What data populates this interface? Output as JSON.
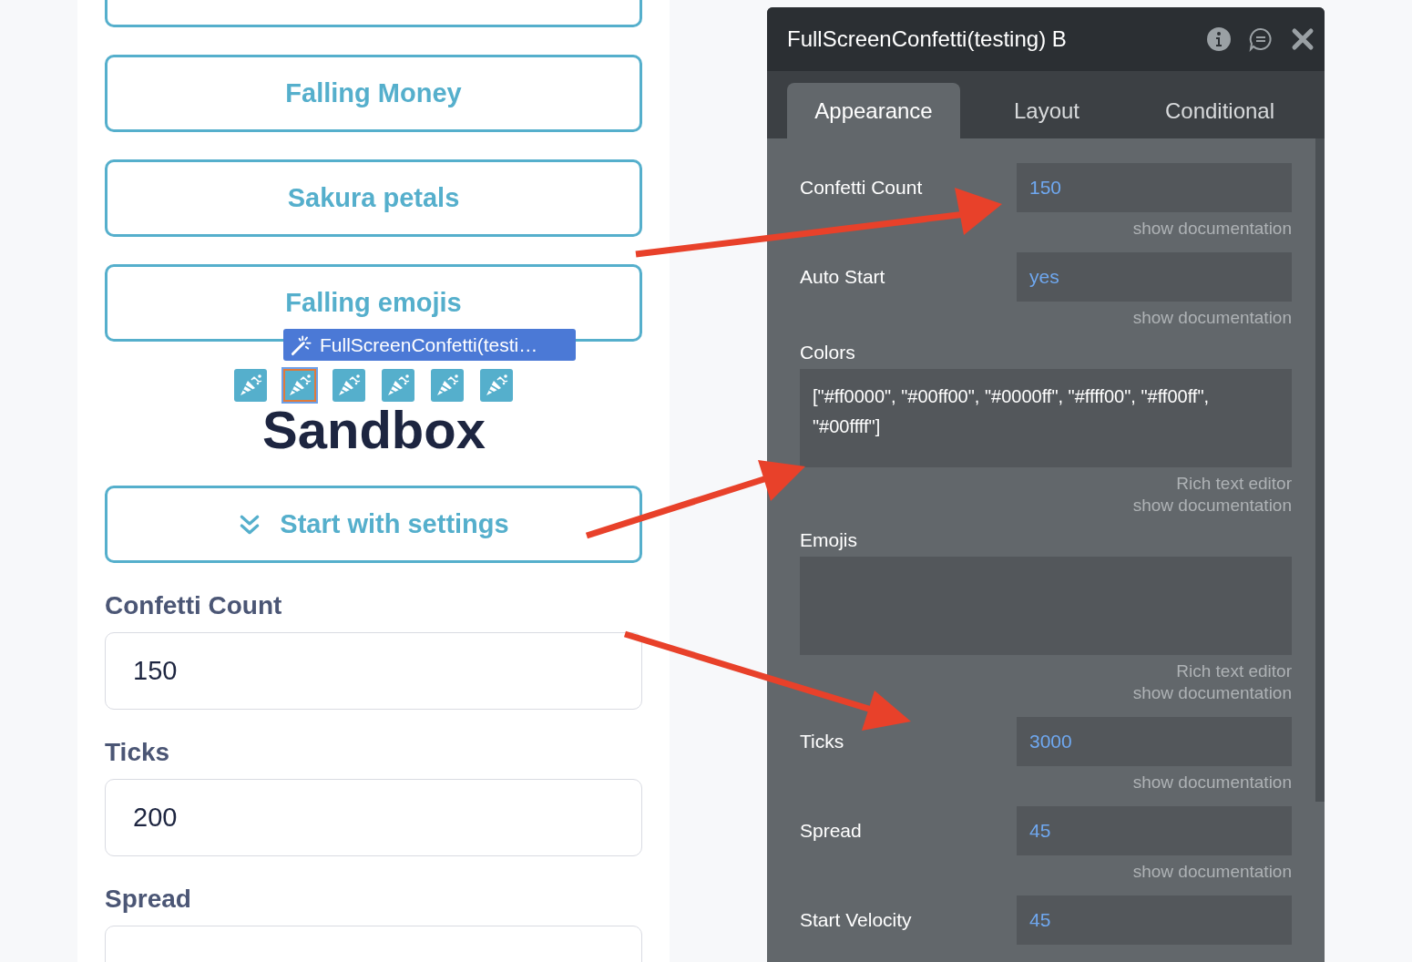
{
  "buttons": [
    {
      "label": "Falling Money"
    },
    {
      "label": "Sakura petals"
    },
    {
      "label": "Falling emojis"
    }
  ],
  "element_tag": {
    "label": "FullScreenConfetti(testi…"
  },
  "element_icons": [
    {
      "selected": false
    },
    {
      "selected": true
    },
    {
      "selected": false
    },
    {
      "selected": false
    },
    {
      "selected": false
    },
    {
      "selected": false
    }
  ],
  "heading": "Sandbox",
  "settings_button": {
    "label": "Start with settings"
  },
  "inputs": [
    {
      "label": "Confetti Count",
      "value": "150"
    },
    {
      "label": "Ticks",
      "value": "200"
    },
    {
      "label": "Spread"
    }
  ],
  "panel": {
    "title": "FullScreenConfetti(testing) B",
    "tabs": [
      {
        "label": "Appearance",
        "selected": true
      },
      {
        "label": "Layout",
        "selected": false
      },
      {
        "label": "Conditional",
        "selected": false
      }
    ],
    "fields": [
      {
        "kind": "inline",
        "label": "Confetti Count",
        "value": "150",
        "notes": [
          "show documentation"
        ]
      },
      {
        "kind": "inline",
        "label": "Auto Start",
        "value": "yes",
        "notes": [
          "show documentation"
        ]
      },
      {
        "kind": "block",
        "label": "Colors",
        "value": "[\"#ff0000\", \"#00ff00\", \"#0000ff\", \"#ffff00\", \"#ff00ff\", \"#00ffff\"]",
        "notes": [
          "Rich text editor",
          "show documentation"
        ]
      },
      {
        "kind": "block",
        "label": "Emojis",
        "notes": [
          "Rich text editor",
          "show documentation"
        ]
      },
      {
        "kind": "inline",
        "label": "Ticks",
        "value": "3000",
        "notes": [
          "show documentation"
        ]
      },
      {
        "kind": "inline",
        "label": "Spread",
        "value": "45",
        "notes": [
          "show documentation"
        ]
      },
      {
        "kind": "inline",
        "label": "Start Velocity",
        "value": "45"
      }
    ]
  }
}
